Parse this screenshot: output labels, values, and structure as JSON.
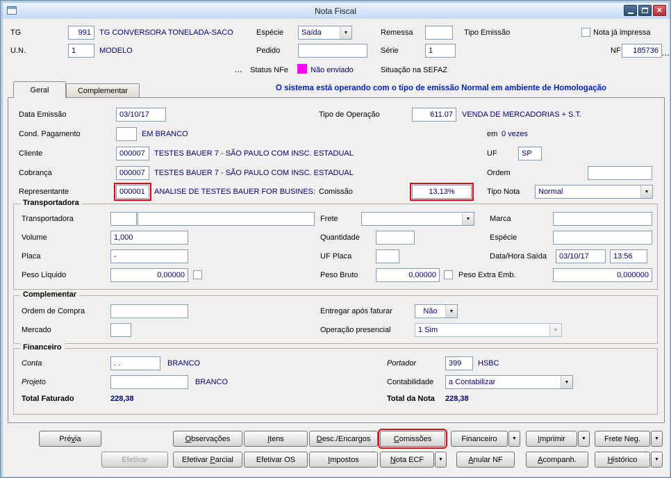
{
  "window": {
    "title": "Nota Fiscal"
  },
  "icons": {
    "dropdown": "▼",
    "more": "...",
    "close": "✕"
  },
  "colors": {
    "value_navy": "#000080",
    "banner_blue": "#0023C6",
    "status_magenta": "#FF00FF",
    "highlight_red": "#E30613"
  },
  "header": {
    "tg": {
      "label": "TG",
      "value": "991",
      "desc": "TG CONVERSORA TONELADA-SACO"
    },
    "especie": {
      "label": "Espécie",
      "value": "Saída"
    },
    "remessa": {
      "label": "Remessa",
      "value": ""
    },
    "tipo_emissao": {
      "label": "Tipo Emissão"
    },
    "nota_ja_impressa": {
      "label": "Nota já impressa",
      "checked": false
    },
    "un": {
      "label": "U.N.",
      "value": "1",
      "desc": "MODELO"
    },
    "pedido": {
      "label": "Pedido",
      "value": ""
    },
    "serie": {
      "label": "Série",
      "value": "1"
    },
    "nf": {
      "label": "NF",
      "value": "185736"
    },
    "status_nfe": {
      "label": "Status NFe",
      "value": "Não enviado"
    },
    "situacao_sefaz": {
      "label": "Situação na SEFAZ"
    }
  },
  "tabs": {
    "geral": "Geral",
    "complementar": "Complementar"
  },
  "banner": "O sistema está operando com o tipo de emissão Normal em ambiente de Homologação",
  "geral": {
    "data_emissao": {
      "label": "Data Emissão",
      "value": "03/10/17"
    },
    "tipo_operacao": {
      "label": "Tipo de Operação",
      "value": "611.07",
      "desc": "VENDA DE MERCADORIAS + S.T."
    },
    "cond_pagamento": {
      "label": "Cond. Pagamento",
      "value": "",
      "desc": "EM BRANCO"
    },
    "em_vezes": {
      "label": "em",
      "value": "0 vezes"
    },
    "cliente": {
      "label": "Cliente",
      "value": "000007",
      "desc": "TESTES BAUER 7 - SÃO PAULO COM INSC. ESTADUAL"
    },
    "uf": {
      "label": "UF",
      "value": "SP"
    },
    "cobranca": {
      "label": "Cobrança",
      "value": "000007",
      "desc": "TESTES BAUER 7 - SÃO PAULO COM INSC. ESTADUAL"
    },
    "ordem": {
      "label": "Ordem",
      "value": ""
    },
    "representante": {
      "label": "Representante",
      "value": "000001",
      "desc": "ANALISE DE TESTES BAUER FOR BUSINES:"
    },
    "comissao": {
      "label": "Comissão",
      "value": "13,13%"
    },
    "tipo_nota": {
      "label": "Tipo Nota",
      "value": "Normal"
    }
  },
  "transportadora": {
    "title": "Transportadora",
    "transportadora": {
      "label": "Transportadora",
      "code": "",
      "name": ""
    },
    "frete": {
      "label": "Frete",
      "value": ""
    },
    "marca": {
      "label": "Marca",
      "value": ""
    },
    "volume": {
      "label": "Volume",
      "value": "1,000"
    },
    "quantidade": {
      "label": "Quantidade",
      "value": ""
    },
    "especie": {
      "label": "Espécie",
      "value": ""
    },
    "placa": {
      "label": "Placa",
      "value": "-"
    },
    "uf_placa": {
      "label": "UF Placa",
      "value": ""
    },
    "data_hora_saida": {
      "label": "Data/Hora Saída",
      "date": "03/10/17",
      "time": "13:56"
    },
    "peso_liquido": {
      "label": "Peso Líquido",
      "value": "0,00000",
      "checked": false
    },
    "peso_bruto": {
      "label": "Peso Bruto",
      "value": "0,00000",
      "checked": false
    },
    "peso_extra": {
      "label": "Peso Extra Emb.",
      "value": "0,000000"
    }
  },
  "complementar": {
    "title": "Complementar",
    "ordem_compra": {
      "label": "Ordem de Compra",
      "value": ""
    },
    "entregar_apos_faturar": {
      "label": "Entregar após faturar",
      "value": "Não"
    },
    "mercado": {
      "label": "Mercado",
      "value": ""
    },
    "operacao_presencial": {
      "label": "Operação presencial",
      "value": "1 Sim"
    }
  },
  "financeiro": {
    "title": "Financeiro",
    "conta": {
      "label": "Conta",
      "value": ". .",
      "desc": "BRANCO"
    },
    "portador": {
      "label": "Portador",
      "value": "399",
      "desc": "HSBC"
    },
    "projeto": {
      "label": "Projeto",
      "value": "",
      "desc": "BRANCO"
    },
    "contabilidade": {
      "label": "Contabilidade",
      "value": "a Contabilizar"
    },
    "total_faturado": {
      "label": "Total Faturado",
      "value": "228,38"
    },
    "total_nota": {
      "label": "Total da Nota",
      "value": "228,38"
    }
  },
  "buttons": {
    "row1": [
      {
        "label": "Prévia",
        "key": "v"
      },
      {
        "label": "Observações",
        "key": "O"
      },
      {
        "label": "Itens",
        "key": "I"
      },
      {
        "label": "Desc./Encargos",
        "key": "D"
      },
      {
        "label": "Comissões",
        "key": "C",
        "highlight": true
      },
      {
        "label": "Financeiro",
        "key": "",
        "dropdown": true
      },
      {
        "label": "Imprimir",
        "key": "I",
        "dropdown": true
      },
      {
        "label": "Frete Neg.",
        "key": "",
        "dropdown": true
      }
    ],
    "row2": [
      {
        "label": "Efetivar",
        "key": "",
        "disabled": true
      },
      {
        "label": "Efetivar Parcial",
        "key": "P"
      },
      {
        "label": "Efetivar OS",
        "key": ""
      },
      {
        "label": "Impostos",
        "key": "I"
      },
      {
        "label": "Nota ECF",
        "key": "N",
        "dropdown": true
      },
      {
        "label": "Anular NF",
        "key": "A"
      },
      {
        "label": "Acompanh.",
        "key": "A"
      },
      {
        "label": "Histórico",
        "key": "H",
        "dropdown": true
      }
    ]
  }
}
